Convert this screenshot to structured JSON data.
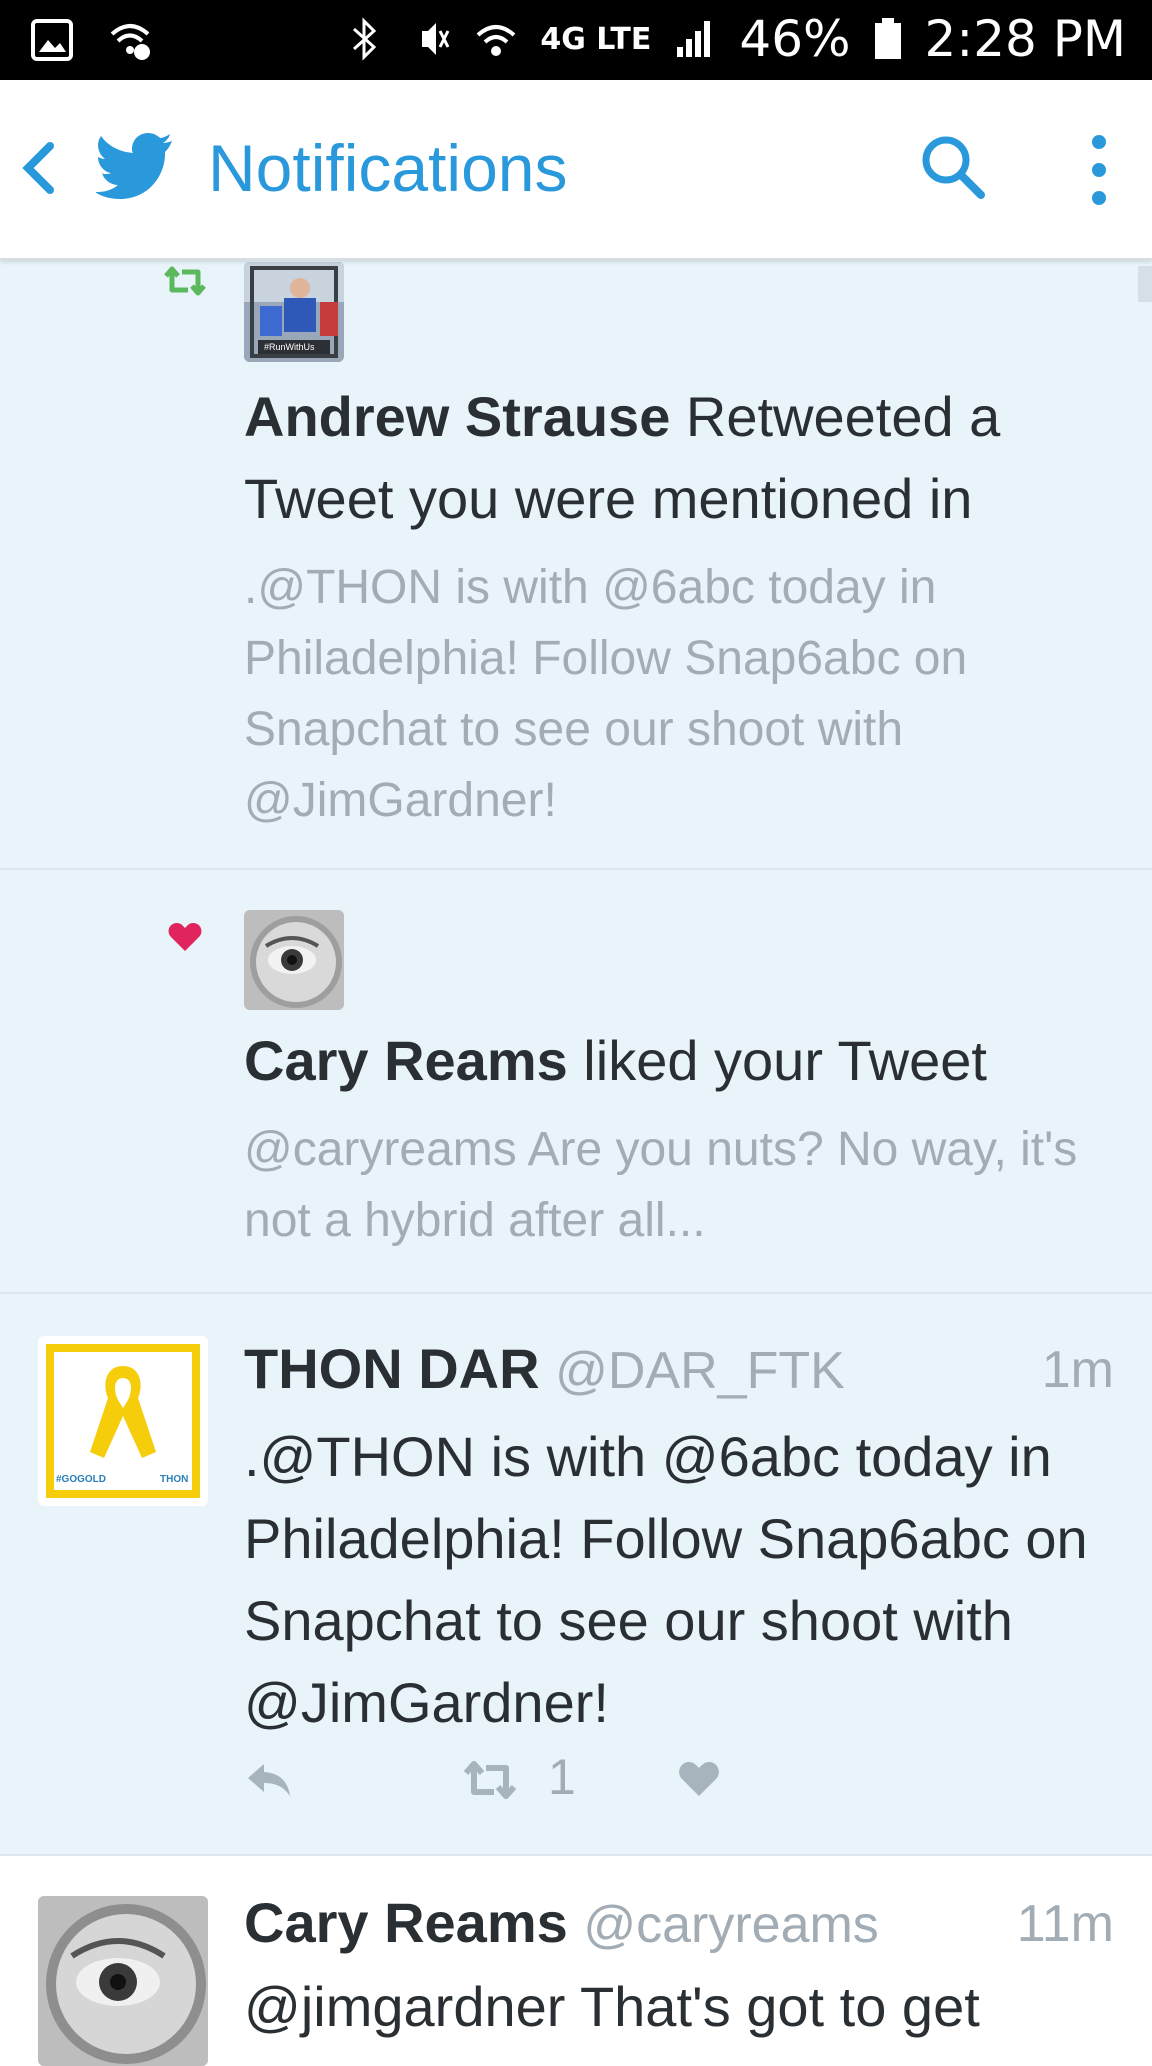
{
  "status_bar": {
    "battery": "46%",
    "time": "2:28 PM",
    "network": "4G LTE"
  },
  "app_bar": {
    "title": "Notifications"
  },
  "notifications": [
    {
      "type": "retweet",
      "name": "Andrew Strause",
      "action": " Retweeted a Tweet you were mentioned in",
      "snippet": ".@THON is with @6abc today in Philadelphia! Follow Snap6abc on Snapchat to see our shoot with @JimGardner!",
      "avatar_caption": "#RunWithUs"
    },
    {
      "type": "like",
      "name": "Cary Reams",
      "action": " liked your Tweet",
      "snippet": "@caryreams Are you nuts? No way, it's not a hybrid after all..."
    }
  ],
  "tweets": [
    {
      "name": "THON DAR",
      "handle": "@DAR_FTK",
      "time": "1m",
      "text": ".@THON is with @6abc today in Philadelphia! Follow Snap6abc on Snapchat to see our shoot with @JimGardner!",
      "retweet_count": "1",
      "avatar_left_text": "#GOGOLD",
      "avatar_right_text": "THON"
    },
    {
      "name": "Cary Reams",
      "handle": "@caryreams",
      "time": "11m",
      "text": "@jimgardner That's got to get"
    }
  ],
  "colors": {
    "accent": "#2a99dc",
    "retweet_green": "#5cb85c",
    "like_red": "#e0245e",
    "highlight_bg": "#e8f3fa",
    "muted_text": "#a2acb5",
    "thon_yellow": "#f5cd0a"
  }
}
